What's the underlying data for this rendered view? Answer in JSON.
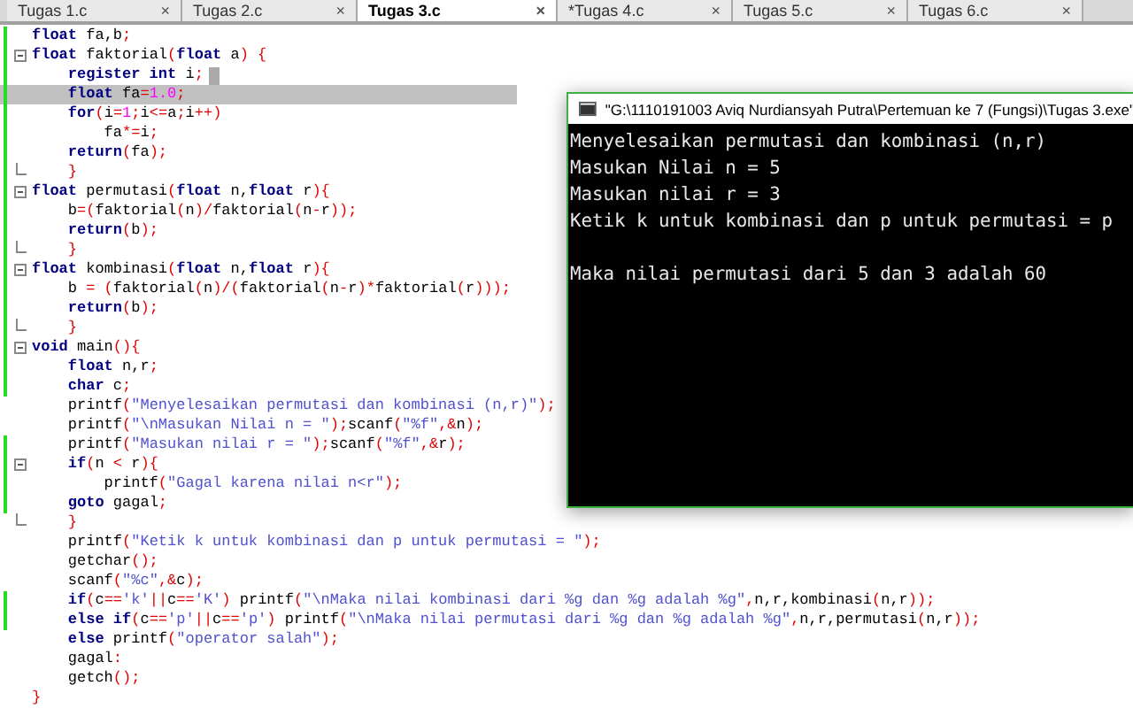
{
  "tabs": [
    {
      "label": "Tugas 1.c",
      "close": "×",
      "selected": false
    },
    {
      "label": "Tugas 2.c",
      "close": "×",
      "selected": false
    },
    {
      "label": "Tugas 3.c",
      "close": "×",
      "selected": true
    },
    {
      "label": "*Tugas 4.c",
      "close": "×",
      "selected": false
    },
    {
      "label": "Tugas 5.c",
      "close": "×",
      "selected": false
    },
    {
      "label": "Tugas 6.c",
      "close": "×",
      "selected": false
    }
  ],
  "editor": {
    "lines": [
      {
        "changed": true,
        "kind": "plain",
        "s": [
          {
            "kind": "keyword",
            "text": "float"
          },
          {
            "kind": "plain",
            "text": " fa,b"
          },
          {
            "kind": "punct",
            "text": ";"
          }
        ]
      },
      {
        "changed": true,
        "kind": "fold_start",
        "s": [
          {
            "kind": "keyword",
            "text": "float"
          },
          {
            "kind": "plain",
            "text": " faktorial"
          },
          {
            "kind": "punct",
            "text": "("
          },
          {
            "kind": "keyword",
            "text": "float"
          },
          {
            "kind": "plain",
            "text": " a"
          },
          {
            "kind": "punct",
            "text": ") {"
          }
        ]
      },
      {
        "changed": true,
        "kind": "plain",
        "cursor": true,
        "s": [
          {
            "kind": "keyword",
            "text": "    register int"
          },
          {
            "kind": "plain",
            "text": " i"
          },
          {
            "kind": "punct",
            "text": ";"
          }
        ]
      },
      {
        "changed": true,
        "kind": "plain",
        "current": true,
        "s": [
          {
            "kind": "keyword",
            "text": "    float"
          },
          {
            "kind": "plain",
            "text": " fa"
          },
          {
            "kind": "punct",
            "text": "="
          },
          {
            "kind": "number",
            "text": "1.0"
          },
          {
            "kind": "punct",
            "text": ";"
          }
        ]
      },
      {
        "changed": true,
        "kind": "plain",
        "s": [
          {
            "kind": "keyword",
            "text": "    for"
          },
          {
            "kind": "punct",
            "text": "("
          },
          {
            "kind": "plain",
            "text": "i"
          },
          {
            "kind": "punct",
            "text": "="
          },
          {
            "kind": "number",
            "text": "1"
          },
          {
            "kind": "punct",
            "text": ";"
          },
          {
            "kind": "plain",
            "text": "i"
          },
          {
            "kind": "punct",
            "text": "<="
          },
          {
            "kind": "plain",
            "text": "a"
          },
          {
            "kind": "punct",
            "text": ";"
          },
          {
            "kind": "plain",
            "text": "i"
          },
          {
            "kind": "punct",
            "text": "++)"
          }
        ]
      },
      {
        "changed": true,
        "kind": "plain",
        "s": [
          {
            "kind": "plain",
            "text": "        fa"
          },
          {
            "kind": "punct",
            "text": "*="
          },
          {
            "kind": "plain",
            "text": "i"
          },
          {
            "kind": "punct",
            "text": ";"
          }
        ]
      },
      {
        "changed": true,
        "kind": "plain",
        "s": [
          {
            "kind": "keyword",
            "text": "    return"
          },
          {
            "kind": "punct",
            "text": "("
          },
          {
            "kind": "plain",
            "text": "fa"
          },
          {
            "kind": "punct",
            "text": ");"
          }
        ]
      },
      {
        "changed": true,
        "kind": "fold_end",
        "s": [
          {
            "kind": "punct",
            "text": "    }"
          }
        ]
      },
      {
        "changed": true,
        "kind": "fold_start",
        "s": [
          {
            "kind": "keyword",
            "text": "float"
          },
          {
            "kind": "plain",
            "text": " permutasi"
          },
          {
            "kind": "punct",
            "text": "("
          },
          {
            "kind": "keyword",
            "text": "float"
          },
          {
            "kind": "plain",
            "text": " n,"
          },
          {
            "kind": "keyword",
            "text": "float"
          },
          {
            "kind": "plain",
            "text": " r"
          },
          {
            "kind": "punct",
            "text": "){"
          }
        ]
      },
      {
        "changed": true,
        "kind": "plain",
        "s": [
          {
            "kind": "plain",
            "text": "    b"
          },
          {
            "kind": "punct",
            "text": "=("
          },
          {
            "kind": "plain",
            "text": "faktorial"
          },
          {
            "kind": "punct",
            "text": "("
          },
          {
            "kind": "plain",
            "text": "n"
          },
          {
            "kind": "punct",
            "text": ")/"
          },
          {
            "kind": "plain",
            "text": "faktorial"
          },
          {
            "kind": "punct",
            "text": "("
          },
          {
            "kind": "plain",
            "text": "n"
          },
          {
            "kind": "punct",
            "text": "-"
          },
          {
            "kind": "plain",
            "text": "r"
          },
          {
            "kind": "punct",
            "text": "));"
          }
        ]
      },
      {
        "changed": true,
        "kind": "plain",
        "s": [
          {
            "kind": "keyword",
            "text": "    return"
          },
          {
            "kind": "punct",
            "text": "("
          },
          {
            "kind": "plain",
            "text": "b"
          },
          {
            "kind": "punct",
            "text": ");"
          }
        ]
      },
      {
        "changed": true,
        "kind": "fold_end",
        "s": [
          {
            "kind": "punct",
            "text": "    }"
          }
        ]
      },
      {
        "changed": true,
        "kind": "fold_start",
        "s": [
          {
            "kind": "keyword",
            "text": "float"
          },
          {
            "kind": "plain",
            "text": " kombinasi"
          },
          {
            "kind": "punct",
            "text": "("
          },
          {
            "kind": "keyword",
            "text": "float"
          },
          {
            "kind": "plain",
            "text": " n,"
          },
          {
            "kind": "keyword",
            "text": "float"
          },
          {
            "kind": "plain",
            "text": " r"
          },
          {
            "kind": "punct",
            "text": "){"
          }
        ]
      },
      {
        "changed": true,
        "kind": "plain",
        "s": [
          {
            "kind": "plain",
            "text": "    b "
          },
          {
            "kind": "punct",
            "text": "= ("
          },
          {
            "kind": "plain",
            "text": "faktorial"
          },
          {
            "kind": "punct",
            "text": "("
          },
          {
            "kind": "plain",
            "text": "n"
          },
          {
            "kind": "punct",
            "text": ")/("
          },
          {
            "kind": "plain",
            "text": "faktorial"
          },
          {
            "kind": "punct",
            "text": "("
          },
          {
            "kind": "plain",
            "text": "n"
          },
          {
            "kind": "punct",
            "text": "-"
          },
          {
            "kind": "plain",
            "text": "r"
          },
          {
            "kind": "punct",
            "text": ")*"
          },
          {
            "kind": "plain",
            "text": "faktorial"
          },
          {
            "kind": "punct",
            "text": "("
          },
          {
            "kind": "plain",
            "text": "r"
          },
          {
            "kind": "punct",
            "text": ")));"
          }
        ]
      },
      {
        "changed": true,
        "kind": "plain",
        "s": [
          {
            "kind": "keyword",
            "text": "    return"
          },
          {
            "kind": "punct",
            "text": "("
          },
          {
            "kind": "plain",
            "text": "b"
          },
          {
            "kind": "punct",
            "text": ");"
          }
        ]
      },
      {
        "changed": true,
        "kind": "fold_end",
        "s": [
          {
            "kind": "punct",
            "text": "    }"
          }
        ]
      },
      {
        "changed": true,
        "kind": "fold_start",
        "s": [
          {
            "kind": "keyword",
            "text": "void"
          },
          {
            "kind": "plain",
            "text": " main"
          },
          {
            "kind": "punct",
            "text": "(){"
          }
        ]
      },
      {
        "changed": true,
        "kind": "plain",
        "s": [
          {
            "kind": "keyword",
            "text": "    float"
          },
          {
            "kind": "plain",
            "text": " n,r"
          },
          {
            "kind": "punct",
            "text": ";"
          }
        ]
      },
      {
        "changed": true,
        "kind": "plain",
        "s": [
          {
            "kind": "keyword",
            "text": "    char"
          },
          {
            "kind": "plain",
            "text": " c"
          },
          {
            "kind": "punct",
            "text": ";"
          }
        ]
      },
      {
        "changed": false,
        "kind": "plain",
        "s": [
          {
            "kind": "plain",
            "text": "    printf"
          },
          {
            "kind": "punct",
            "text": "("
          },
          {
            "kind": "string",
            "text": "\"Menyelesaikan permutasi dan kombinasi (n,r)\""
          },
          {
            "kind": "punct",
            "text": ");"
          }
        ]
      },
      {
        "changed": false,
        "kind": "plain",
        "s": [
          {
            "kind": "plain",
            "text": "    printf"
          },
          {
            "kind": "punct",
            "text": "("
          },
          {
            "kind": "string",
            "text": "\"\\nMasukan Nilai n = \""
          },
          {
            "kind": "punct",
            "text": ");"
          },
          {
            "kind": "plain",
            "text": "scanf"
          },
          {
            "kind": "punct",
            "text": "("
          },
          {
            "kind": "string",
            "text": "\"%f\""
          },
          {
            "kind": "punct",
            "text": ",&"
          },
          {
            "kind": "plain",
            "text": "n"
          },
          {
            "kind": "punct",
            "text": ");"
          }
        ]
      },
      {
        "changed": true,
        "kind": "plain",
        "s": [
          {
            "kind": "plain",
            "text": "    printf"
          },
          {
            "kind": "punct",
            "text": "("
          },
          {
            "kind": "string",
            "text": "\"Masukan nilai r = \""
          },
          {
            "kind": "punct",
            "text": ");"
          },
          {
            "kind": "plain",
            "text": "scanf"
          },
          {
            "kind": "punct",
            "text": "("
          },
          {
            "kind": "string",
            "text": "\"%f\""
          },
          {
            "kind": "punct",
            "text": ",&"
          },
          {
            "kind": "plain",
            "text": "r"
          },
          {
            "kind": "punct",
            "text": ");"
          }
        ]
      },
      {
        "changed": true,
        "kind": "fold_start",
        "s": [
          {
            "kind": "keyword",
            "text": "    if"
          },
          {
            "kind": "punct",
            "text": "("
          },
          {
            "kind": "plain",
            "text": "n "
          },
          {
            "kind": "punct",
            "text": "<"
          },
          {
            "kind": "plain",
            "text": " r"
          },
          {
            "kind": "punct",
            "text": "){"
          }
        ]
      },
      {
        "changed": true,
        "kind": "plain",
        "s": [
          {
            "kind": "plain",
            "text": "        printf"
          },
          {
            "kind": "punct",
            "text": "("
          },
          {
            "kind": "string",
            "text": "\"Gagal karena nilai n<r\""
          },
          {
            "kind": "punct",
            "text": ");"
          }
        ]
      },
      {
        "changed": true,
        "kind": "plain",
        "s": [
          {
            "kind": "keyword",
            "text": "    goto"
          },
          {
            "kind": "plain",
            "text": " gagal"
          },
          {
            "kind": "punct",
            "text": ";"
          }
        ]
      },
      {
        "changed": false,
        "kind": "fold_end",
        "s": [
          {
            "kind": "punct",
            "text": "    }"
          }
        ]
      },
      {
        "changed": false,
        "kind": "plain",
        "s": [
          {
            "kind": "plain",
            "text": "    printf"
          },
          {
            "kind": "punct",
            "text": "("
          },
          {
            "kind": "string",
            "text": "\"Ketik k untuk kombinasi dan p untuk permutasi = \""
          },
          {
            "kind": "punct",
            "text": ");"
          }
        ]
      },
      {
        "changed": false,
        "kind": "plain",
        "s": [
          {
            "kind": "plain",
            "text": "    getchar"
          },
          {
            "kind": "punct",
            "text": "();"
          }
        ]
      },
      {
        "changed": false,
        "kind": "plain",
        "s": [
          {
            "kind": "plain",
            "text": "    scanf"
          },
          {
            "kind": "punct",
            "text": "("
          },
          {
            "kind": "string",
            "text": "\"%c\""
          },
          {
            "kind": "punct",
            "text": ",&"
          },
          {
            "kind": "plain",
            "text": "c"
          },
          {
            "kind": "punct",
            "text": ");"
          }
        ]
      },
      {
        "changed": true,
        "kind": "plain",
        "s": [
          {
            "kind": "keyword",
            "text": "    if"
          },
          {
            "kind": "punct",
            "text": "("
          },
          {
            "kind": "plain",
            "text": "c"
          },
          {
            "kind": "punct",
            "text": "=="
          },
          {
            "kind": "string",
            "text": "'k'"
          },
          {
            "kind": "punct",
            "text": "||"
          },
          {
            "kind": "plain",
            "text": "c"
          },
          {
            "kind": "punct",
            "text": "=="
          },
          {
            "kind": "string",
            "text": "'K'"
          },
          {
            "kind": "punct",
            "text": ")"
          },
          {
            "kind": "plain",
            "text": " printf"
          },
          {
            "kind": "punct",
            "text": "("
          },
          {
            "kind": "string",
            "text": "\"\\nMaka nilai kombinasi dari %g dan %g adalah %g\""
          },
          {
            "kind": "punct",
            "text": ","
          },
          {
            "kind": "plain",
            "text": "n,r,kombinasi"
          },
          {
            "kind": "punct",
            "text": "("
          },
          {
            "kind": "plain",
            "text": "n,r"
          },
          {
            "kind": "punct",
            "text": "));"
          }
        ]
      },
      {
        "changed": true,
        "kind": "plain",
        "s": [
          {
            "kind": "keyword",
            "text": "    else if"
          },
          {
            "kind": "punct",
            "text": "("
          },
          {
            "kind": "plain",
            "text": "c"
          },
          {
            "kind": "punct",
            "text": "=="
          },
          {
            "kind": "string",
            "text": "'p'"
          },
          {
            "kind": "punct",
            "text": "||"
          },
          {
            "kind": "plain",
            "text": "c"
          },
          {
            "kind": "punct",
            "text": "=="
          },
          {
            "kind": "string",
            "text": "'p'"
          },
          {
            "kind": "punct",
            "text": ")"
          },
          {
            "kind": "plain",
            "text": " printf"
          },
          {
            "kind": "punct",
            "text": "("
          },
          {
            "kind": "string",
            "text": "\"\\nMaka nilai permutasi dari %g dan %g adalah %g\""
          },
          {
            "kind": "punct",
            "text": ","
          },
          {
            "kind": "plain",
            "text": "n,r,permutasi"
          },
          {
            "kind": "punct",
            "text": "("
          },
          {
            "kind": "plain",
            "text": "n,r"
          },
          {
            "kind": "punct",
            "text": "));"
          }
        ]
      },
      {
        "changed": false,
        "kind": "plain",
        "s": [
          {
            "kind": "keyword",
            "text": "    else"
          },
          {
            "kind": "plain",
            "text": " printf"
          },
          {
            "kind": "punct",
            "text": "("
          },
          {
            "kind": "string",
            "text": "\"operator salah\""
          },
          {
            "kind": "punct",
            "text": ");"
          }
        ]
      },
      {
        "changed": false,
        "kind": "plain",
        "s": [
          {
            "kind": "plain",
            "text": "    gagal"
          },
          {
            "kind": "punct",
            "text": ":"
          }
        ]
      },
      {
        "changed": false,
        "kind": "plain",
        "s": [
          {
            "kind": "plain",
            "text": "    getch"
          },
          {
            "kind": "punct",
            "text": "();"
          }
        ]
      },
      {
        "changed": false,
        "kind": "plain",
        "s": [
          {
            "kind": "punct",
            "text": "}"
          }
        ]
      }
    ]
  },
  "console": {
    "title": "\"G:\\1110191003 Aviq Nurdiansyah Putra\\Pertemuan ke 7 (Fungsi)\\Tugas 3.exe\"",
    "lines": [
      "Menyelesaikan permutasi dan kombinasi (n,r)",
      "Masukan Nilai n = 5",
      "Masukan nilai r = 3",
      "Ketik k untuk kombinasi dan p untuk permutasi = p"
    ],
    "result": "Maka nilai permutasi dari 5 dan 3 adalah 60"
  }
}
